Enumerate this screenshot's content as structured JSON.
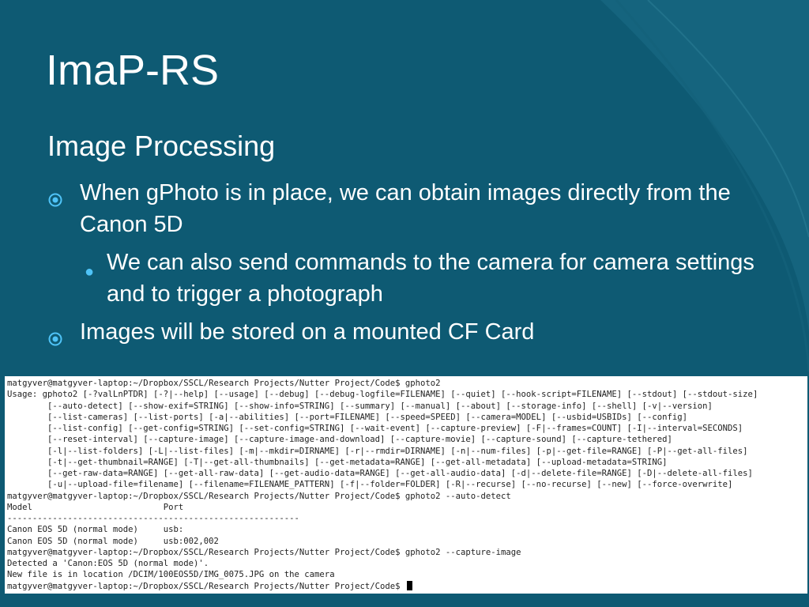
{
  "slide": {
    "title": "ImaP-RS",
    "subtitle": "Image Processing",
    "bullets": [
      {
        "level": 1,
        "text": "When gPhoto is in place, we can obtain images directly from the Canon 5D"
      },
      {
        "level": 2,
        "text": "We can also send commands to the camera for camera settings and to trigger a photograph"
      },
      {
        "level": 1,
        "text": "Images will be stored on a mounted CF Card"
      }
    ]
  },
  "colors": {
    "background": "#0e5a73",
    "arc": "#1c6d86",
    "bullet_accent": "#4fc3f7"
  },
  "terminal": {
    "lines": [
      "matgyver@matgyver-laptop:~/Dropbox/SSCL/Research Projects/Nutter Project/Code$ gphoto2",
      "Usage: gphoto2 [-?valLnPTDR] [-?|--help] [--usage] [--debug] [--debug-logfile=FILENAME] [--quiet] [--hook-script=FILENAME] [--stdout] [--stdout-size]",
      "        [--auto-detect] [--show-exif=STRING] [--show-info=STRING] [--summary] [--manual] [--about] [--storage-info] [--shell] [-v|--version]",
      "        [--list-cameras] [--list-ports] [-a|--abilities] [--port=FILENAME] [--speed=SPEED] [--camera=MODEL] [--usbid=USBIDs] [--config]",
      "        [--list-config] [--get-config=STRING] [--set-config=STRING] [--wait-event] [--capture-preview] [-F|--frames=COUNT] [-I|--interval=SECONDS]",
      "        [--reset-interval] [--capture-image] [--capture-image-and-download] [--capture-movie] [--capture-sound] [--capture-tethered]",
      "        [-l|--list-folders] [-L|--list-files] [-m|--mkdir=DIRNAME] [-r|--rmdir=DIRNAME] [-n|--num-files] [-p|--get-file=RANGE] [-P|--get-all-files]",
      "        [-t|--get-thumbnail=RANGE] [-T|--get-all-thumbnails] [--get-metadata=RANGE] [--get-all-metadata] [--upload-metadata=STRING]",
      "        [--get-raw-data=RANGE] [--get-all-raw-data] [--get-audio-data=RANGE] [--get-all-audio-data] [-d|--delete-file=RANGE] [-D|--delete-all-files]",
      "        [-u|--upload-file=filename] [--filename=FILENAME_PATTERN] [-f|--folder=FOLDER] [-R|--recurse] [--no-recurse] [--new] [--force-overwrite]",
      "matgyver@matgyver-laptop:~/Dropbox/SSCL/Research Projects/Nutter Project/Code$ gphoto2 --auto-detect",
      "Model                          Port",
      "----------------------------------------------------------",
      "Canon EOS 5D (normal mode)     usb:",
      "Canon EOS 5D (normal mode)     usb:002,002",
      "matgyver@matgyver-laptop:~/Dropbox/SSCL/Research Projects/Nutter Project/Code$ gphoto2 --capture-image",
      "Detected a 'Canon:EOS 5D (normal mode)'.",
      "New file is in location /DCIM/100EOS5D/IMG_0075.JPG on the camera",
      "matgyver@matgyver-laptop:~/Dropbox/SSCL/Research Projects/Nutter Project/Code$ "
    ]
  }
}
